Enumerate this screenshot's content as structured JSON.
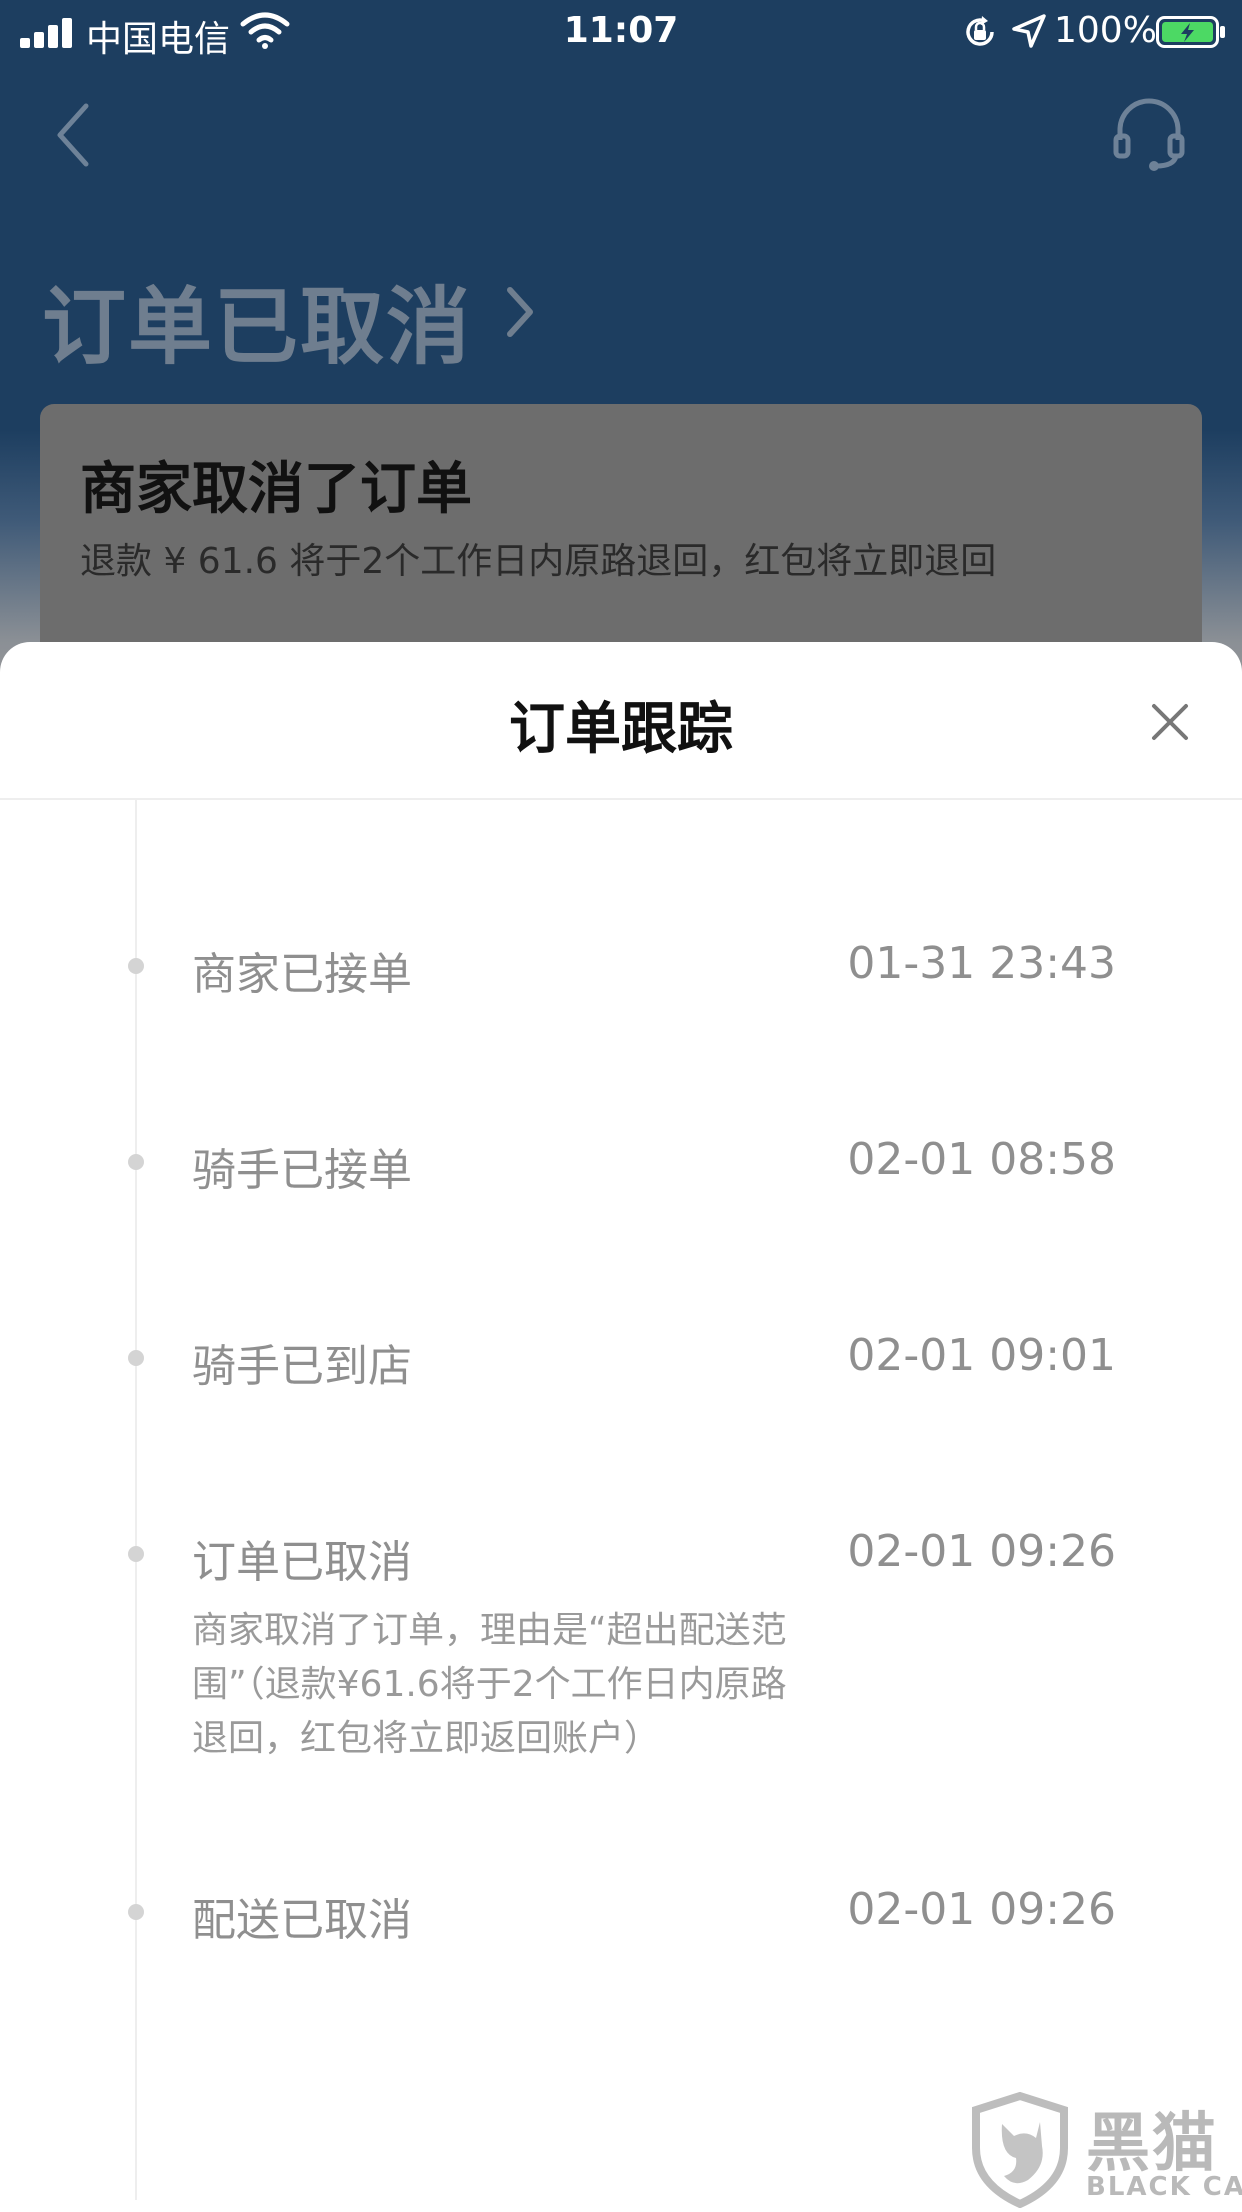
{
  "status_bar": {
    "carrier": "中国电信",
    "time": "11:07",
    "battery": "100%"
  },
  "background_page": {
    "status_title": "订单已取消",
    "card_title": "商家取消了订单",
    "card_desc": "退款 ¥ 61.6 将于2个工作日内原路退回，红包将立即退回"
  },
  "sheet": {
    "title": "订单跟踪",
    "timeline": [
      {
        "label": "商家已接单",
        "time": "01-31 23:43"
      },
      {
        "label": "骑手已接单",
        "time": "02-01 08:58"
      },
      {
        "label": "骑手已到店",
        "time": "02-01 09:01"
      },
      {
        "label": "订单已取消",
        "time": "02-01 09:26",
        "note_lines": [
          "商家取消了订单，理由是“超出配送范",
          "围”（退款¥61.6将于2个工作日内原路",
          "退回，红包将立即返回账户）"
        ]
      },
      {
        "label": "配送已取消",
        "time": "02-01 09:26"
      }
    ]
  },
  "watermark": {
    "cn": "黑猫",
    "en": "BLACK CAT"
  },
  "colors": {
    "header_blue": "#1d3e60",
    "text_gray": "#8f8f8f",
    "dot_gray": "#d4d4d4",
    "battery_green": "#4cd964"
  }
}
